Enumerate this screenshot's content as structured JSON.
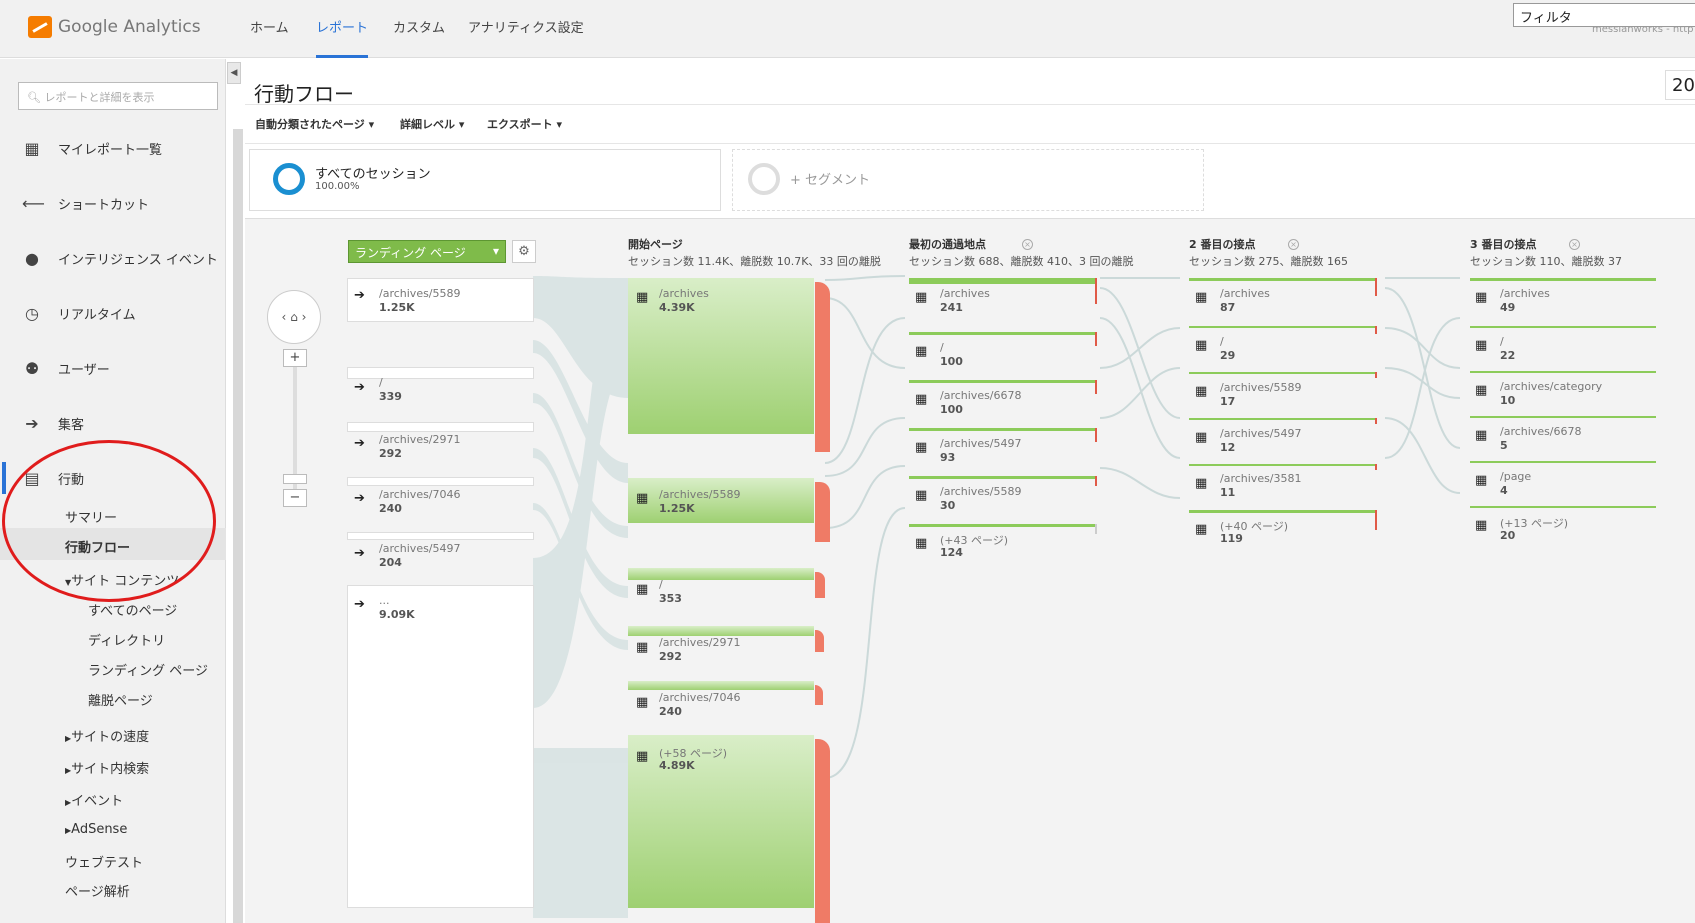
{
  "header": {
    "logo_text": "Google Analytics",
    "nav": [
      "ホーム",
      "レポート",
      "カスタム",
      "アナリティクス設定"
    ],
    "account": "messianworks - http",
    "filter_value": "フィルタ"
  },
  "sidebar": {
    "search_placeholder": "レポートと詳細を表示",
    "items": [
      {
        "label": "マイレポート一覧",
        "icon": "grid-icon"
      },
      {
        "label": "ショートカット",
        "icon": "arrow-left-icon"
      },
      {
        "label": "インテリジェンス イベント",
        "icon": "bulb-icon"
      },
      {
        "label": "リアルタイム",
        "icon": "clock-icon"
      },
      {
        "label": "ユーザー",
        "icon": "users-icon"
      },
      {
        "label": "集客",
        "icon": "acquisition-icon"
      },
      {
        "label": "行動",
        "icon": "behavior-icon"
      }
    ],
    "behavior_sub": [
      "サマリー",
      "行動フロー",
      "サイト コンテンツ"
    ],
    "content_sub": [
      "すべてのページ",
      "ディレクトリ",
      "ランディング ページ",
      "離脱ページ"
    ],
    "more_sub": [
      "サイトの速度",
      "サイト内検索",
      "イベント",
      "AdSense",
      "ウェブテスト",
      "ページ解析"
    ]
  },
  "page": {
    "title": "行動フロー",
    "year": "20",
    "toolbar": [
      "自動分類されたページ",
      "詳細レベル",
      "エクスポート"
    ]
  },
  "segments": {
    "all_name": "すべてのセッション",
    "all_pct": "100.00%",
    "add_label": "+ セグメント"
  },
  "flow": {
    "dimension": "ランディング ページ",
    "landing_nodes": [
      {
        "path": "/archives/5589",
        "value": "1.25K"
      },
      {
        "path": "/",
        "value": "339"
      },
      {
        "path": "/archives/2971",
        "value": "292"
      },
      {
        "path": "/archives/7046",
        "value": "240"
      },
      {
        "path": "/archives/5497",
        "value": "204"
      },
      {
        "path": "...",
        "value": "9.09K"
      }
    ],
    "columns": [
      {
        "title": "開始ページ",
        "sub": "セッション数 11.4K、離脱数 10.7K、33 回の離脱",
        "nodes": [
          {
            "path": "/archives",
            "value": "4.39K"
          },
          {
            "path": "/archives/5589",
            "value": "1.25K"
          },
          {
            "path": "/",
            "value": "353"
          },
          {
            "path": "/archives/2971",
            "value": "292"
          },
          {
            "path": "/archives/7046",
            "value": "240"
          },
          {
            "path": "(+58 ページ)",
            "value": "4.89K"
          }
        ]
      },
      {
        "title": "最初の通過地点",
        "sub": "セッション数 688、離脱数 410、3 回の離脱",
        "nodes": [
          {
            "path": "/archives",
            "value": "241"
          },
          {
            "path": "/",
            "value": "100"
          },
          {
            "path": "/archives/6678",
            "value": "100"
          },
          {
            "path": "/archives/5497",
            "value": "93"
          },
          {
            "path": "/archives/5589",
            "value": "30"
          },
          {
            "path": "(+43 ページ)",
            "value": "124"
          }
        ]
      },
      {
        "title": "2 番目の接点",
        "sub": "セッション数 275、離脱数 165",
        "nodes": [
          {
            "path": "/archives",
            "value": "87"
          },
          {
            "path": "/",
            "value": "29"
          },
          {
            "path": "/archives/5589",
            "value": "17"
          },
          {
            "path": "/archives/5497",
            "value": "12"
          },
          {
            "path": "/archives/3581",
            "value": "11"
          },
          {
            "path": "(+40 ページ)",
            "value": "119"
          }
        ]
      },
      {
        "title": "3 番目の接点",
        "sub": "セッション数 110、離脱数 37",
        "nodes": [
          {
            "path": "/archives",
            "value": "49"
          },
          {
            "path": "/",
            "value": "22"
          },
          {
            "path": "/archives/category",
            "value": "10"
          },
          {
            "path": "/archives/6678",
            "value": "5"
          },
          {
            "path": "/page",
            "value": "4"
          },
          {
            "path": "(+13 ページ)",
            "value": "20"
          }
        ]
      }
    ]
  }
}
